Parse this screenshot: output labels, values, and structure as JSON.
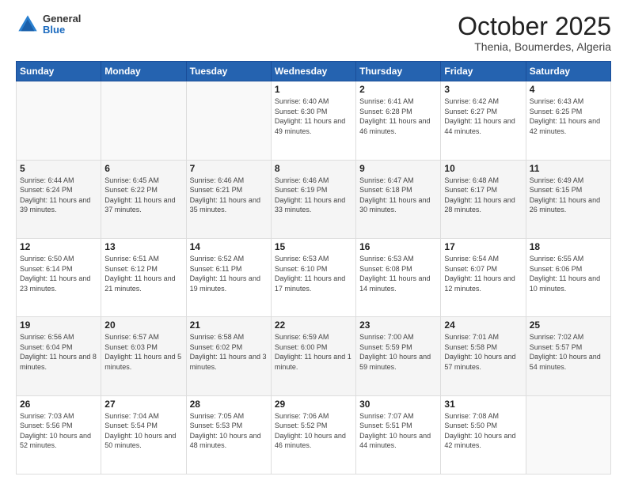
{
  "header": {
    "logo": {
      "general": "General",
      "blue": "Blue"
    },
    "title": "October 2025",
    "location": "Thenia, Boumerdes, Algeria"
  },
  "weekdays": [
    "Sunday",
    "Monday",
    "Tuesday",
    "Wednesday",
    "Thursday",
    "Friday",
    "Saturday"
  ],
  "weeks": [
    [
      {
        "day": "",
        "sunrise": "",
        "sunset": "",
        "daylight": ""
      },
      {
        "day": "",
        "sunrise": "",
        "sunset": "",
        "daylight": ""
      },
      {
        "day": "",
        "sunrise": "",
        "sunset": "",
        "daylight": ""
      },
      {
        "day": "1",
        "sunrise": "Sunrise: 6:40 AM",
        "sunset": "Sunset: 6:30 PM",
        "daylight": "Daylight: 11 hours and 49 minutes."
      },
      {
        "day": "2",
        "sunrise": "Sunrise: 6:41 AM",
        "sunset": "Sunset: 6:28 PM",
        "daylight": "Daylight: 11 hours and 46 minutes."
      },
      {
        "day": "3",
        "sunrise": "Sunrise: 6:42 AM",
        "sunset": "Sunset: 6:27 PM",
        "daylight": "Daylight: 11 hours and 44 minutes."
      },
      {
        "day": "4",
        "sunrise": "Sunrise: 6:43 AM",
        "sunset": "Sunset: 6:25 PM",
        "daylight": "Daylight: 11 hours and 42 minutes."
      }
    ],
    [
      {
        "day": "5",
        "sunrise": "Sunrise: 6:44 AM",
        "sunset": "Sunset: 6:24 PM",
        "daylight": "Daylight: 11 hours and 39 minutes."
      },
      {
        "day": "6",
        "sunrise": "Sunrise: 6:45 AM",
        "sunset": "Sunset: 6:22 PM",
        "daylight": "Daylight: 11 hours and 37 minutes."
      },
      {
        "day": "7",
        "sunrise": "Sunrise: 6:46 AM",
        "sunset": "Sunset: 6:21 PM",
        "daylight": "Daylight: 11 hours and 35 minutes."
      },
      {
        "day": "8",
        "sunrise": "Sunrise: 6:46 AM",
        "sunset": "Sunset: 6:19 PM",
        "daylight": "Daylight: 11 hours and 33 minutes."
      },
      {
        "day": "9",
        "sunrise": "Sunrise: 6:47 AM",
        "sunset": "Sunset: 6:18 PM",
        "daylight": "Daylight: 11 hours and 30 minutes."
      },
      {
        "day": "10",
        "sunrise": "Sunrise: 6:48 AM",
        "sunset": "Sunset: 6:17 PM",
        "daylight": "Daylight: 11 hours and 28 minutes."
      },
      {
        "day": "11",
        "sunrise": "Sunrise: 6:49 AM",
        "sunset": "Sunset: 6:15 PM",
        "daylight": "Daylight: 11 hours and 26 minutes."
      }
    ],
    [
      {
        "day": "12",
        "sunrise": "Sunrise: 6:50 AM",
        "sunset": "Sunset: 6:14 PM",
        "daylight": "Daylight: 11 hours and 23 minutes."
      },
      {
        "day": "13",
        "sunrise": "Sunrise: 6:51 AM",
        "sunset": "Sunset: 6:12 PM",
        "daylight": "Daylight: 11 hours and 21 minutes."
      },
      {
        "day": "14",
        "sunrise": "Sunrise: 6:52 AM",
        "sunset": "Sunset: 6:11 PM",
        "daylight": "Daylight: 11 hours and 19 minutes."
      },
      {
        "day": "15",
        "sunrise": "Sunrise: 6:53 AM",
        "sunset": "Sunset: 6:10 PM",
        "daylight": "Daylight: 11 hours and 17 minutes."
      },
      {
        "day": "16",
        "sunrise": "Sunrise: 6:53 AM",
        "sunset": "Sunset: 6:08 PM",
        "daylight": "Daylight: 11 hours and 14 minutes."
      },
      {
        "day": "17",
        "sunrise": "Sunrise: 6:54 AM",
        "sunset": "Sunset: 6:07 PM",
        "daylight": "Daylight: 11 hours and 12 minutes."
      },
      {
        "day": "18",
        "sunrise": "Sunrise: 6:55 AM",
        "sunset": "Sunset: 6:06 PM",
        "daylight": "Daylight: 11 hours and 10 minutes."
      }
    ],
    [
      {
        "day": "19",
        "sunrise": "Sunrise: 6:56 AM",
        "sunset": "Sunset: 6:04 PM",
        "daylight": "Daylight: 11 hours and 8 minutes."
      },
      {
        "day": "20",
        "sunrise": "Sunrise: 6:57 AM",
        "sunset": "Sunset: 6:03 PM",
        "daylight": "Daylight: 11 hours and 5 minutes."
      },
      {
        "day": "21",
        "sunrise": "Sunrise: 6:58 AM",
        "sunset": "Sunset: 6:02 PM",
        "daylight": "Daylight: 11 hours and 3 minutes."
      },
      {
        "day": "22",
        "sunrise": "Sunrise: 6:59 AM",
        "sunset": "Sunset: 6:00 PM",
        "daylight": "Daylight: 11 hours and 1 minute."
      },
      {
        "day": "23",
        "sunrise": "Sunrise: 7:00 AM",
        "sunset": "Sunset: 5:59 PM",
        "daylight": "Daylight: 10 hours and 59 minutes."
      },
      {
        "day": "24",
        "sunrise": "Sunrise: 7:01 AM",
        "sunset": "Sunset: 5:58 PM",
        "daylight": "Daylight: 10 hours and 57 minutes."
      },
      {
        "day": "25",
        "sunrise": "Sunrise: 7:02 AM",
        "sunset": "Sunset: 5:57 PM",
        "daylight": "Daylight: 10 hours and 54 minutes."
      }
    ],
    [
      {
        "day": "26",
        "sunrise": "Sunrise: 7:03 AM",
        "sunset": "Sunset: 5:56 PM",
        "daylight": "Daylight: 10 hours and 52 minutes."
      },
      {
        "day": "27",
        "sunrise": "Sunrise: 7:04 AM",
        "sunset": "Sunset: 5:54 PM",
        "daylight": "Daylight: 10 hours and 50 minutes."
      },
      {
        "day": "28",
        "sunrise": "Sunrise: 7:05 AM",
        "sunset": "Sunset: 5:53 PM",
        "daylight": "Daylight: 10 hours and 48 minutes."
      },
      {
        "day": "29",
        "sunrise": "Sunrise: 7:06 AM",
        "sunset": "Sunset: 5:52 PM",
        "daylight": "Daylight: 10 hours and 46 minutes."
      },
      {
        "day": "30",
        "sunrise": "Sunrise: 7:07 AM",
        "sunset": "Sunset: 5:51 PM",
        "daylight": "Daylight: 10 hours and 44 minutes."
      },
      {
        "day": "31",
        "sunrise": "Sunrise: 7:08 AM",
        "sunset": "Sunset: 5:50 PM",
        "daylight": "Daylight: 10 hours and 42 minutes."
      },
      {
        "day": "",
        "sunrise": "",
        "sunset": "",
        "daylight": ""
      }
    ]
  ]
}
